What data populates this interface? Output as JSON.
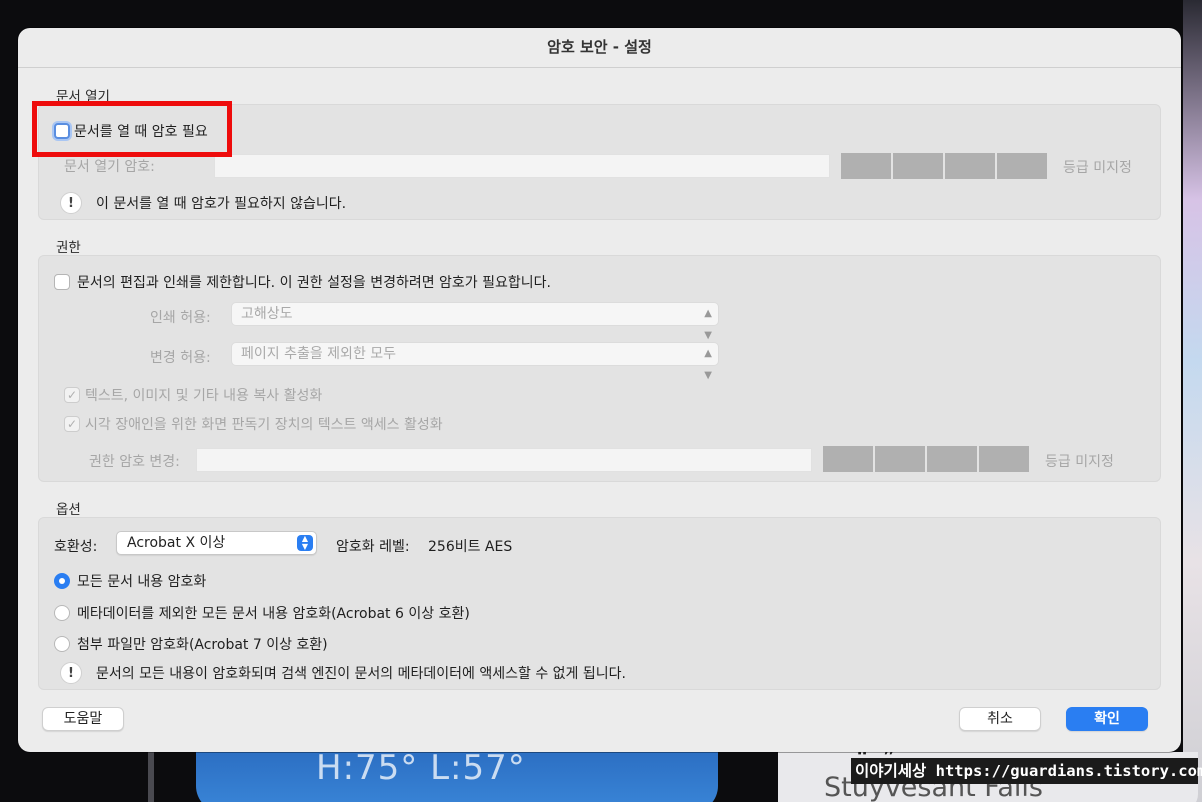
{
  "dialog": {
    "title": "암호 보안 - 설정"
  },
  "open_section": {
    "heading": "문서 열기",
    "require_password_label": "문서를 열 때 암호 필요",
    "password_field_label": "문서 열기 암호:",
    "strength_label": "등급 미지정",
    "info_text": "이 문서를 열 때 암호가 필요하지 않습니다."
  },
  "permissions_section": {
    "heading": "권한",
    "restrict_label": "문서의 편집과 인쇄를 제한합니다. 이 권한 설정을 변경하려면 암호가 필요합니다.",
    "print_label": "인쇄 허용:",
    "print_value": "고해상도",
    "change_label": "변경 허용:",
    "change_value": "페이지 추출을 제외한 모두",
    "copy_label": "텍스트, 이미지 및 기타 내용 복사 활성화",
    "screenreader_label": "시각 장애인을 위한 화면 판독기 장치의 텍스트 액세스 활성화",
    "password_field_label": "권한 암호 변경:",
    "strength_label": "등급 미지정"
  },
  "options_section": {
    "heading": "옵션",
    "compat_label": "호환성:",
    "compat_value": "Acrobat X 이상",
    "level_label": "암호화 레벨:",
    "level_value": "256비트 AES",
    "radio_all": "모든 문서 내용 암호화",
    "radio_except_meta": "메타데이터를 제외한 모든 문서 내용 암호화(Acrobat 6 이상 호환)",
    "radio_attachments": "첨부 파일만 암호화(Acrobat 7 이상 호환)",
    "info_text": "문서의 모든 내용이 암호화되며 검색 엔진이 문서의 메타데이터에 액세스할 수 없게 됩니다."
  },
  "buttons": {
    "help": "도움말",
    "cancel": "취소",
    "ok": "확인"
  },
  "background": {
    "weather": "H:75° L:57°",
    "place": "Stuyvesant Falls",
    "watermark": "이야기세상 https://guardians.tistory.com"
  },
  "colors": {
    "accent": "#2a7ef2",
    "highlight": "#ee0c0c",
    "strength_meter": "#b0b0b0"
  }
}
